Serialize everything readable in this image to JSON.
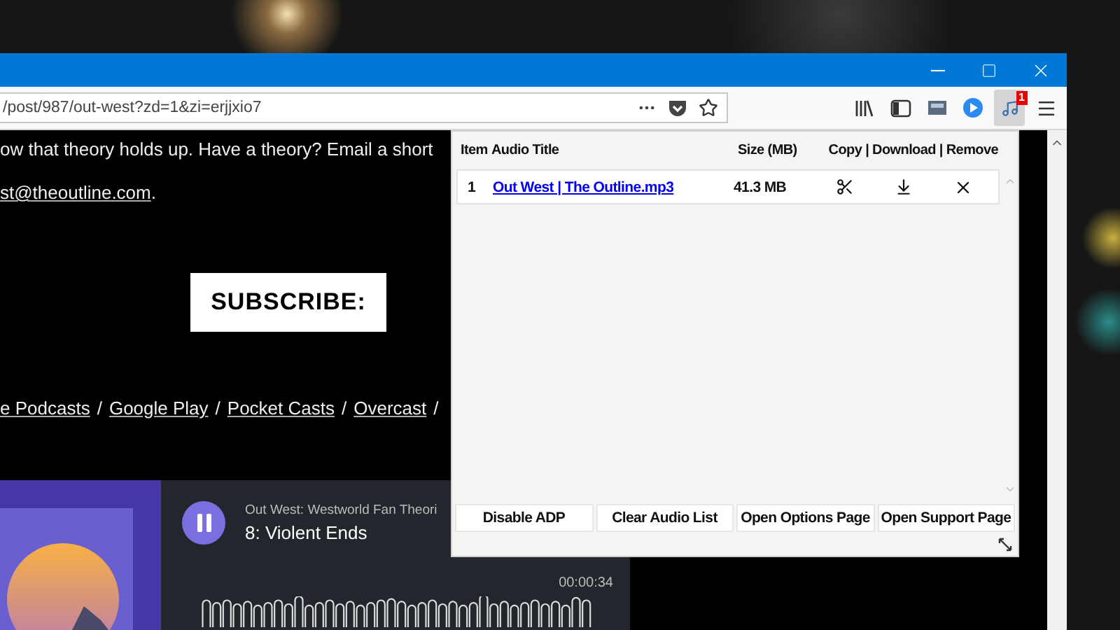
{
  "window": {
    "url": "/post/987/out-west?zd=1&zi=erjjxio7"
  },
  "toolbar": {
    "extension_badge": "1",
    "extension_active": true
  },
  "article": {
    "intro": "ow that theory holds up. Have a theory? Email a short",
    "email_link": "st@theoutline.com",
    "email_after": ".",
    "subscribe": "SUBSCRIBE:",
    "podcast_links": [
      "e Podcasts",
      "Google Play",
      "Pocket Casts",
      "Overcast"
    ],
    "link_separator": "/"
  },
  "player": {
    "show": "Out West: Westworld Fan Theori",
    "episode": "8: Violent Ends",
    "time": "00:00:34",
    "playing": true
  },
  "popup": {
    "columns": [
      "Item",
      "Audio Title",
      "Size (MB)",
      "Copy | Download | Remove"
    ],
    "rows": [
      {
        "item": "1",
        "title": "Out West | The Outline.mp3",
        "size": "41.3 MB"
      }
    ],
    "buttons": [
      "Disable ADP",
      "Clear Audio List",
      "Open Options Page",
      "Open Support Page"
    ]
  }
}
